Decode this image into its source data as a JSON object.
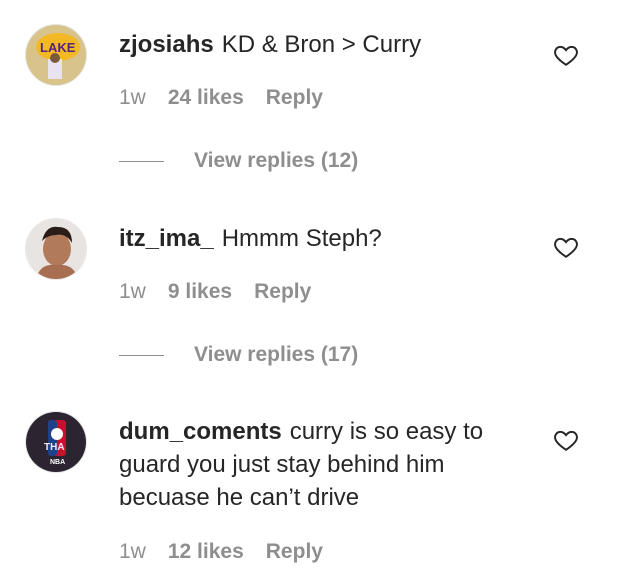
{
  "comments": [
    {
      "username": "zjosiahs",
      "text": "KD & Bron > Curry",
      "time": "1w",
      "likes": "24 likes",
      "reply": "Reply",
      "view_replies": "View replies (12)",
      "avatar_icon": "lakers-logo-avatar"
    },
    {
      "username": "itz_ima_",
      "text": "Hmmm Steph?",
      "time": "1w",
      "likes": "9 likes",
      "reply": "Reply",
      "view_replies": "View replies (17)",
      "avatar_icon": "person-avatar"
    },
    {
      "username": "dum_coments",
      "text": "curry is so easy to guard you just stay behind him becuase he can’t drive",
      "time": "1w",
      "likes": "12 likes",
      "reply": "Reply",
      "avatar_icon": "nba-logo-avatar"
    }
  ],
  "colors": {
    "text": "#262626",
    "secondary": "#8e8e8e",
    "background": "#ffffff"
  }
}
